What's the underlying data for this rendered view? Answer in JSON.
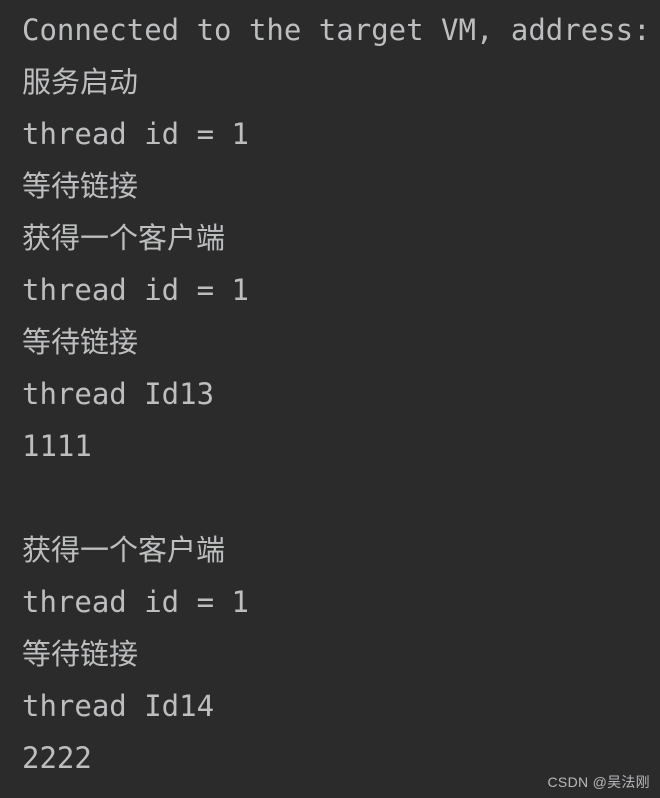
{
  "window": {
    "title": "Console Output",
    "background_color": "#2b2b2b",
    "text_color": "#bcbec0"
  },
  "console": {
    "name": "debugger-console-output",
    "lines": [
      {
        "text": "Connected to the target VM, address:",
        "type": "system",
        "truncated": true
      },
      {
        "text": "服务启动",
        "type": "app"
      },
      {
        "text": "thread id = 1",
        "type": "app"
      },
      {
        "text": "等待链接",
        "type": "app"
      },
      {
        "text": "获得一个客户端",
        "type": "app"
      },
      {
        "text": "thread id = 1",
        "type": "app"
      },
      {
        "text": "等待链接",
        "type": "app"
      },
      {
        "text": "thread Id13",
        "type": "app"
      },
      {
        "text": "1111",
        "type": "app"
      },
      {
        "text": "",
        "type": "blank"
      },
      {
        "text": "获得一个客户端",
        "type": "app"
      },
      {
        "text": "thread id = 1",
        "type": "app"
      },
      {
        "text": "等待链接",
        "type": "app"
      },
      {
        "text": "thread Id14",
        "type": "app"
      },
      {
        "text": "2222",
        "type": "app"
      }
    ]
  },
  "watermark": {
    "text": "CSDN @吴法刚"
  }
}
